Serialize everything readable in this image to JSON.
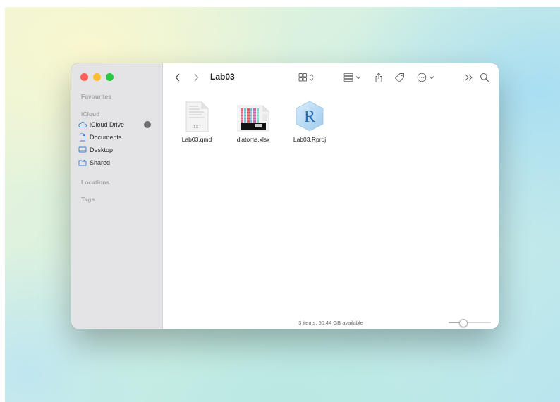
{
  "window": {
    "title": "Lab03",
    "traffic_lights": [
      "close",
      "minimize",
      "zoom"
    ]
  },
  "sidebar": {
    "favourites_header": "Favourites",
    "icloud_header": "iCloud",
    "items": [
      {
        "label": "iCloud Drive",
        "icon": "cloud-icon"
      },
      {
        "label": "Documents",
        "icon": "document-icon"
      },
      {
        "label": "Desktop",
        "icon": "desktop-icon"
      },
      {
        "label": "Shared",
        "icon": "shared-folder-icon"
      }
    ],
    "locations_header": "Locations",
    "tags_header": "Tags"
  },
  "toolbar": {
    "back_icon": "chevron-left-icon",
    "forward_icon": "chevron-right-icon",
    "view_icon": "icon-grid-icon",
    "group_icon": "group-icon",
    "share_icon": "share-icon",
    "tag_icon": "tag-icon",
    "more_icon": "ellipsis-circle-icon",
    "overflow_icon": "double-chevron-icon",
    "search_icon": "search-icon"
  },
  "files": [
    {
      "name": "Lab03.qmd",
      "icon": "text-file-icon",
      "badge": "TXT"
    },
    {
      "name": "diatoms.xlsx",
      "icon": "spreadsheet-thumbnail-icon"
    },
    {
      "name": "Lab03.Rproj",
      "icon": "r-project-icon",
      "badge": "R"
    }
  ],
  "status": {
    "text": "3 items, 50.44 GB available",
    "zoom_level": 0.3
  },
  "colors": {
    "sidebar_bg": "#e4e4e6",
    "close": "#fe5f57",
    "minimize": "#febc2e",
    "zoom": "#28c840",
    "r_icon_blue": "#2a6cb5"
  }
}
